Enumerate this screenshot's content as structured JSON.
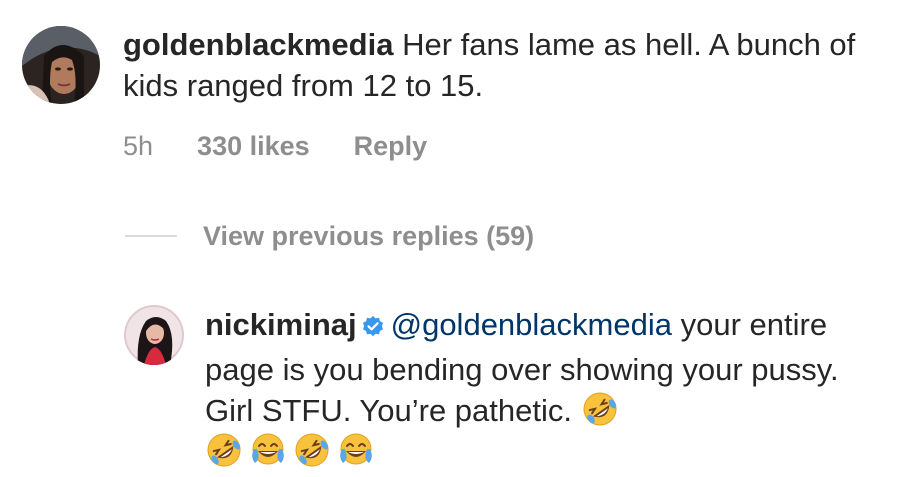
{
  "comment1": {
    "username": "goldenblackmedia",
    "text": " Her fans lame as hell. A bunch of kids ranged from 12 to 15.",
    "time": "5h",
    "likes": "330 likes",
    "reply_label": "Reply"
  },
  "replies": {
    "view_previous_label": "View previous replies (59)"
  },
  "comment2": {
    "username": "nickiminaj",
    "mention": "@goldenblackmedia",
    "text": " your entire page is you bending over showing your pussy. Girl STFU. You’re pathetic. ",
    "emojis": [
      "rolling-on-floor-laughing",
      "rolling-on-floor-laughing",
      "face-with-tears-of-joy",
      "rolling-on-floor-laughing",
      "face-with-tears-of-joy"
    ]
  },
  "colors": {
    "text": "#262626",
    "secondary": "#8e8e8e",
    "mention": "#003569",
    "verified": "#3897f0",
    "emoji_yellow": "#f9c23c"
  }
}
